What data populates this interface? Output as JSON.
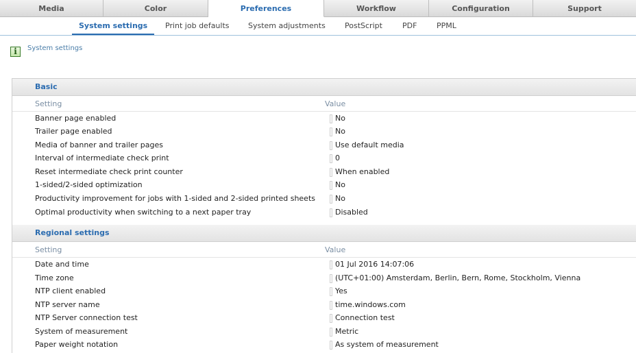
{
  "tabs": [
    "Media",
    "Color",
    "Preferences",
    "Workflow",
    "Configuration",
    "Support"
  ],
  "subtabs": [
    "System settings",
    "Print job defaults",
    "System adjustments",
    "PostScript",
    "PDF",
    "PPML"
  ],
  "crumb": "System settings",
  "info_icon_glyph": "i",
  "basic": {
    "title": "Basic",
    "col_setting": "Setting",
    "col_value": "Value",
    "rows": [
      {
        "label": "Banner page enabled",
        "value": "No"
      },
      {
        "label": "Trailer page enabled",
        "value": "No"
      },
      {
        "label": "Media of banner and trailer pages",
        "value": "Use default media"
      },
      {
        "label": "Interval of intermediate check print",
        "value": "0"
      },
      {
        "label": "Reset intermediate check print counter",
        "value": "When enabled"
      },
      {
        "label": "1-sided/2-sided optimization",
        "value": "No"
      },
      {
        "label": "Productivity improvement for jobs with 1-sided and 2-sided printed sheets",
        "value": "No"
      },
      {
        "label": "Optimal productivity when switching to a next paper tray",
        "value": "Disabled"
      }
    ]
  },
  "regional": {
    "title": "Regional settings",
    "col_setting": "Setting",
    "col_value": "Value",
    "rows": [
      {
        "label": "Date and time",
        "value": "01 Jul 2016 14:07:06"
      },
      {
        "label": "Time zone",
        "value": "(UTC+01:00) Amsterdam, Berlin, Bern, Rome, Stockholm, Vienna"
      },
      {
        "label": "NTP client enabled",
        "value": "Yes"
      },
      {
        "label": "NTP server name",
        "value": "time.windows.com"
      },
      {
        "label": "NTP Server connection test",
        "value": "Connection test"
      },
      {
        "label": "System of measurement",
        "value": "Metric"
      },
      {
        "label": "Paper weight notation",
        "value": "As system of measurement"
      }
    ]
  }
}
